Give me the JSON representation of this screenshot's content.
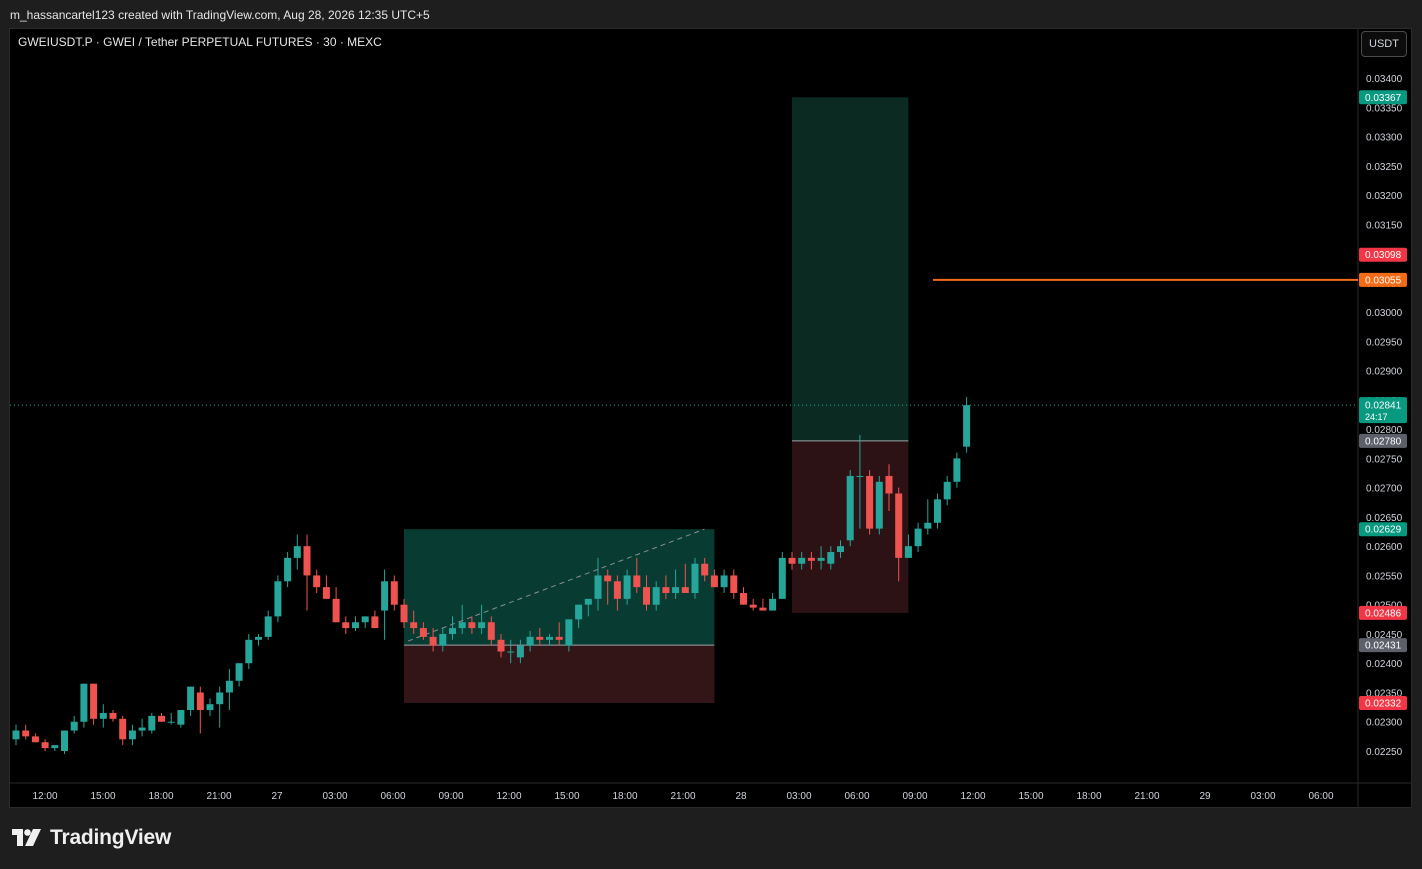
{
  "header": {
    "credit": "m_hassancartel123 created with TradingView.com, Aug 28, 2026 12:35 UTC+5"
  },
  "symbol": {
    "title": "GWEIUSDT.P · GWEI / Tether PERPETUAL FUTURES · 30 · MEXC"
  },
  "currency_button": "USDT",
  "brand": {
    "name": "TradingView",
    "logo_icon": "tradingview-logo-icon"
  },
  "colors": {
    "up": "#26a69a",
    "down": "#ef5350",
    "profit_zone": "#0a3d32",
    "loss_zone": "#331416",
    "orange_line": "#f36b16",
    "grey_label": "#5d606b"
  },
  "chart_data": {
    "type": "candlestick",
    "timeframe": "30",
    "y_axis": {
      "range": [
        0.0222,
        0.0354
      ],
      "ticks": [
        "0.03400",
        "0.03350",
        "0.03300",
        "0.03250",
        "0.03200",
        "0.03150",
        "0.03100",
        "0.03050",
        "0.03000",
        "0.02950",
        "0.02900",
        "0.02850",
        "0.02800",
        "0.02750",
        "0.02700",
        "0.02650",
        "0.02600",
        "0.02550",
        "0.02500",
        "0.02450",
        "0.02400",
        "0.02350",
        "0.02300",
        "0.02250"
      ]
    },
    "x_axis": {
      "ticks": [
        "12:00",
        "15:00",
        "18:00",
        "21:00",
        "27",
        "03:00",
        "06:00",
        "09:00",
        "12:00",
        "15:00",
        "18:00",
        "21:00",
        "28",
        "03:00",
        "06:00",
        "09:00",
        "12:00",
        "15:00",
        "18:00",
        "21:00",
        "29",
        "03:00",
        "06:00"
      ]
    },
    "candles": [
      {
        "o": 0.0227,
        "h": 0.02295,
        "l": 0.0226,
        "c": 0.02285
      },
      {
        "o": 0.02285,
        "h": 0.02295,
        "l": 0.0227,
        "c": 0.02275
      },
      {
        "o": 0.02275,
        "h": 0.0228,
        "l": 0.02265,
        "c": 0.02265
      },
      {
        "o": 0.02265,
        "h": 0.0227,
        "l": 0.0225,
        "c": 0.02255
      },
      {
        "o": 0.02255,
        "h": 0.0226,
        "l": 0.0225,
        "c": 0.0226
      },
      {
        "o": 0.0225,
        "h": 0.02285,
        "l": 0.02245,
        "c": 0.02285
      },
      {
        "o": 0.02285,
        "h": 0.0231,
        "l": 0.0228,
        "c": 0.023
      },
      {
        "o": 0.023,
        "h": 0.02365,
        "l": 0.0229,
        "c": 0.02365
      },
      {
        "o": 0.02365,
        "h": 0.02365,
        "l": 0.02295,
        "c": 0.02305
      },
      {
        "o": 0.02305,
        "h": 0.0233,
        "l": 0.0229,
        "c": 0.02315
      },
      {
        "o": 0.02315,
        "h": 0.0232,
        "l": 0.023,
        "c": 0.02305
      },
      {
        "o": 0.02305,
        "h": 0.0231,
        "l": 0.0226,
        "c": 0.0227
      },
      {
        "o": 0.0227,
        "h": 0.02295,
        "l": 0.0226,
        "c": 0.02285
      },
      {
        "o": 0.02285,
        "h": 0.02305,
        "l": 0.02275,
        "c": 0.0229
      },
      {
        "o": 0.02285,
        "h": 0.02315,
        "l": 0.0228,
        "c": 0.0231
      },
      {
        "o": 0.0231,
        "h": 0.02315,
        "l": 0.023,
        "c": 0.023
      },
      {
        "o": 0.023,
        "h": 0.02315,
        "l": 0.02295,
        "c": 0.023
      },
      {
        "o": 0.02295,
        "h": 0.0232,
        "l": 0.0229,
        "c": 0.0232
      },
      {
        "o": 0.0232,
        "h": 0.0236,
        "l": 0.0231,
        "c": 0.0236
      },
      {
        "o": 0.0235,
        "h": 0.0236,
        "l": 0.0228,
        "c": 0.0232
      },
      {
        "o": 0.0232,
        "h": 0.0234,
        "l": 0.0231,
        "c": 0.0233
      },
      {
        "o": 0.0233,
        "h": 0.0236,
        "l": 0.0229,
        "c": 0.0235
      },
      {
        "o": 0.0235,
        "h": 0.0239,
        "l": 0.0232,
        "c": 0.0237
      },
      {
        "o": 0.0237,
        "h": 0.024,
        "l": 0.0236,
        "c": 0.024
      },
      {
        "o": 0.024,
        "h": 0.0245,
        "l": 0.0239,
        "c": 0.0244
      },
      {
        "o": 0.0244,
        "h": 0.0245,
        "l": 0.0243,
        "c": 0.02445
      },
      {
        "o": 0.02445,
        "h": 0.0249,
        "l": 0.0244,
        "c": 0.0248
      },
      {
        "o": 0.0248,
        "h": 0.0255,
        "l": 0.0247,
        "c": 0.0254
      },
      {
        "o": 0.0254,
        "h": 0.0259,
        "l": 0.0253,
        "c": 0.0258
      },
      {
        "o": 0.0258,
        "h": 0.0262,
        "l": 0.0256,
        "c": 0.026
      },
      {
        "o": 0.026,
        "h": 0.0262,
        "l": 0.0249,
        "c": 0.0255
      },
      {
        "o": 0.0255,
        "h": 0.0256,
        "l": 0.0252,
        "c": 0.0253
      },
      {
        "o": 0.0253,
        "h": 0.0255,
        "l": 0.0251,
        "c": 0.0251
      },
      {
        "o": 0.0251,
        "h": 0.0253,
        "l": 0.0247,
        "c": 0.0247
      },
      {
        "o": 0.0247,
        "h": 0.0248,
        "l": 0.0245,
        "c": 0.0246
      },
      {
        "o": 0.0246,
        "h": 0.0248,
        "l": 0.02455,
        "c": 0.0247
      },
      {
        "o": 0.0247,
        "h": 0.0248,
        "l": 0.0246,
        "c": 0.0248
      },
      {
        "o": 0.0248,
        "h": 0.0249,
        "l": 0.0246,
        "c": 0.0246
      },
      {
        "o": 0.0249,
        "h": 0.0256,
        "l": 0.0244,
        "c": 0.0254
      },
      {
        "o": 0.0254,
        "h": 0.0255,
        "l": 0.0249,
        "c": 0.025
      },
      {
        "o": 0.025,
        "h": 0.0251,
        "l": 0.0246,
        "c": 0.0247
      },
      {
        "o": 0.0247,
        "h": 0.0249,
        "l": 0.0245,
        "c": 0.0246
      },
      {
        "o": 0.0246,
        "h": 0.0247,
        "l": 0.0244,
        "c": 0.02445
      },
      {
        "o": 0.02445,
        "h": 0.0246,
        "l": 0.0242,
        "c": 0.0243
      },
      {
        "o": 0.0243,
        "h": 0.0246,
        "l": 0.0242,
        "c": 0.0245
      },
      {
        "o": 0.0245,
        "h": 0.0248,
        "l": 0.0244,
        "c": 0.0246
      },
      {
        "o": 0.0246,
        "h": 0.025,
        "l": 0.0245,
        "c": 0.0247
      },
      {
        "o": 0.0247,
        "h": 0.0248,
        "l": 0.0245,
        "c": 0.0246
      },
      {
        "o": 0.0246,
        "h": 0.025,
        "l": 0.0245,
        "c": 0.0247
      },
      {
        "o": 0.0247,
        "h": 0.0248,
        "l": 0.0243,
        "c": 0.0244
      },
      {
        "o": 0.0244,
        "h": 0.0245,
        "l": 0.0241,
        "c": 0.0242
      },
      {
        "o": 0.0242,
        "h": 0.0244,
        "l": 0.024,
        "c": 0.0242
      },
      {
        "o": 0.0241,
        "h": 0.0244,
        "l": 0.024,
        "c": 0.0243
      },
      {
        "o": 0.0243,
        "h": 0.02455,
        "l": 0.0242,
        "c": 0.02445
      },
      {
        "o": 0.02445,
        "h": 0.0246,
        "l": 0.0243,
        "c": 0.0244
      },
      {
        "o": 0.0244,
        "h": 0.0245,
        "l": 0.0243,
        "c": 0.02445
      },
      {
        "o": 0.02445,
        "h": 0.0247,
        "l": 0.0243,
        "c": 0.0244
      },
      {
        "o": 0.0243,
        "h": 0.0247,
        "l": 0.0242,
        "c": 0.02475
      },
      {
        "o": 0.02475,
        "h": 0.025,
        "l": 0.0246,
        "c": 0.025
      },
      {
        "o": 0.025,
        "h": 0.0251,
        "l": 0.0248,
        "c": 0.0251
      },
      {
        "o": 0.0251,
        "h": 0.0258,
        "l": 0.0249,
        "c": 0.0255
      },
      {
        "o": 0.0255,
        "h": 0.0256,
        "l": 0.025,
        "c": 0.0254
      },
      {
        "o": 0.0254,
        "h": 0.0255,
        "l": 0.0249,
        "c": 0.0251
      },
      {
        "o": 0.0251,
        "h": 0.0256,
        "l": 0.025,
        "c": 0.0255
      },
      {
        "o": 0.0255,
        "h": 0.0258,
        "l": 0.0252,
        "c": 0.0253
      },
      {
        "o": 0.0253,
        "h": 0.0255,
        "l": 0.0249,
        "c": 0.025
      },
      {
        "o": 0.025,
        "h": 0.0254,
        "l": 0.0249,
        "c": 0.0253
      },
      {
        "o": 0.0253,
        "h": 0.0255,
        "l": 0.0251,
        "c": 0.0252
      },
      {
        "o": 0.0252,
        "h": 0.0256,
        "l": 0.0251,
        "c": 0.0253
      },
      {
        "o": 0.0253,
        "h": 0.0257,
        "l": 0.0252,
        "c": 0.0252
      },
      {
        "o": 0.0252,
        "h": 0.0258,
        "l": 0.0251,
        "c": 0.0257
      },
      {
        "o": 0.0257,
        "h": 0.0258,
        "l": 0.0254,
        "c": 0.0255
      },
      {
        "o": 0.0255,
        "h": 0.0256,
        "l": 0.0253,
        "c": 0.0253
      },
      {
        "o": 0.0253,
        "h": 0.0256,
        "l": 0.0252,
        "c": 0.0255
      },
      {
        "o": 0.0255,
        "h": 0.0256,
        "l": 0.0251,
        "c": 0.0252
      },
      {
        "o": 0.0252,
        "h": 0.0253,
        "l": 0.025,
        "c": 0.025
      },
      {
        "o": 0.025,
        "h": 0.0251,
        "l": 0.0249,
        "c": 0.02495
      },
      {
        "o": 0.02495,
        "h": 0.0251,
        "l": 0.0249,
        "c": 0.0249
      },
      {
        "o": 0.0249,
        "h": 0.0252,
        "l": 0.0249,
        "c": 0.0251
      },
      {
        "o": 0.0251,
        "h": 0.0259,
        "l": 0.0251,
        "c": 0.0258
      },
      {
        "o": 0.0258,
        "h": 0.0259,
        "l": 0.0256,
        "c": 0.0257
      },
      {
        "o": 0.0257,
        "h": 0.0259,
        "l": 0.0256,
        "c": 0.0258
      },
      {
        "o": 0.0258,
        "h": 0.0259,
        "l": 0.0256,
        "c": 0.02575
      },
      {
        "o": 0.02575,
        "h": 0.026,
        "l": 0.0256,
        "c": 0.0258
      },
      {
        "o": 0.0257,
        "h": 0.026,
        "l": 0.0256,
        "c": 0.0259
      },
      {
        "o": 0.0259,
        "h": 0.0261,
        "l": 0.0258,
        "c": 0.026
      },
      {
        "o": 0.0261,
        "h": 0.0273,
        "l": 0.026,
        "c": 0.0272
      },
      {
        "o": 0.0272,
        "h": 0.0279,
        "l": 0.0263,
        "c": 0.0272
      },
      {
        "o": 0.0272,
        "h": 0.0273,
        "l": 0.0262,
        "c": 0.0263
      },
      {
        "o": 0.0263,
        "h": 0.0272,
        "l": 0.0262,
        "c": 0.0271
      },
      {
        "o": 0.0272,
        "h": 0.0274,
        "l": 0.0266,
        "c": 0.0269
      },
      {
        "o": 0.0269,
        "h": 0.027,
        "l": 0.0254,
        "c": 0.0258
      },
      {
        "o": 0.0258,
        "h": 0.0262,
        "l": 0.0258,
        "c": 0.026
      },
      {
        "o": 0.026,
        "h": 0.0264,
        "l": 0.0259,
        "c": 0.0263
      },
      {
        "o": 0.0263,
        "h": 0.0268,
        "l": 0.0262,
        "c": 0.0264
      },
      {
        "o": 0.0264,
        "h": 0.0269,
        "l": 0.0263,
        "c": 0.0268
      },
      {
        "o": 0.0268,
        "h": 0.0272,
        "l": 0.0267,
        "c": 0.0271
      },
      {
        "o": 0.0271,
        "h": 0.0276,
        "l": 0.027,
        "c": 0.0275
      },
      {
        "o": 0.0277,
        "h": 0.02855,
        "l": 0.0276,
        "c": 0.02841
      }
    ],
    "positions": [
      {
        "type": "long",
        "start_index": 40,
        "end_index": 72,
        "entry": 0.02431,
        "target": 0.02629,
        "stop": 0.02332
      },
      {
        "type": "long",
        "start_index": 80,
        "end_index": 92,
        "entry": 0.0278,
        "target": 0.03367,
        "stop": 0.02486
      }
    ],
    "current_price": 0.02841,
    "countdown": "24:17",
    "horizontal_line": 0.03055,
    "price_labels": [
      {
        "text": "0.03367",
        "value": 0.03367,
        "color": "#089981"
      },
      {
        "text": "0.03098",
        "value": 0.03098,
        "color": "#f23645"
      },
      {
        "text": "0.03055",
        "value": 0.03055,
        "color": "#f36b16"
      },
      {
        "text": "0.02780",
        "value": 0.0278,
        "color": "#5d606b"
      },
      {
        "text": "0.02629",
        "value": 0.02629,
        "color": "#089981"
      },
      {
        "text": "0.02486",
        "value": 0.02486,
        "color": "#f23645"
      },
      {
        "text": "0.02431",
        "value": 0.02431,
        "color": "#5d606b"
      },
      {
        "text": "0.02332",
        "value": 0.02332,
        "color": "#f23645"
      }
    ]
  }
}
